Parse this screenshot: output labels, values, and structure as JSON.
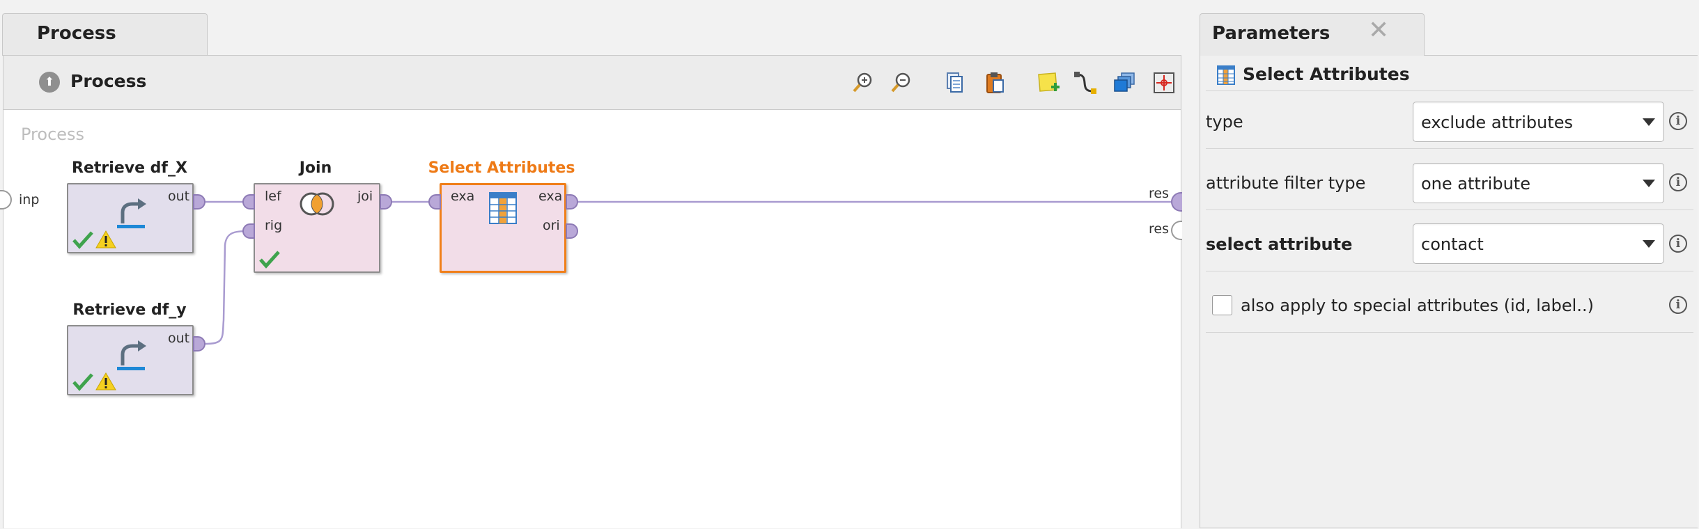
{
  "process_panel": {
    "tab_label": "Process",
    "breadcrumb": "Process",
    "canvas_title": "Process",
    "toolbar_icons": [
      "zoom-in-icon",
      "zoom-out-icon",
      "copy-icon",
      "paste-icon",
      "add-note-icon",
      "auto-wire-icon",
      "layers-icon",
      "fit-view-icon"
    ],
    "input_port_label": "inp",
    "result_ports": [
      "res",
      "res"
    ]
  },
  "operators": {
    "retrieve_x": {
      "title": "Retrieve df_X",
      "out_port": "out",
      "status": [
        "check-icon",
        "warning-icon"
      ]
    },
    "retrieve_y": {
      "title": "Retrieve df_y",
      "out_port": "out",
      "status": [
        "check-icon",
        "warning-icon"
      ]
    },
    "join": {
      "title": "Join",
      "in_ports": [
        "lef",
        "rig"
      ],
      "out_port": "joi",
      "status": [
        "check-icon"
      ]
    },
    "select_attributes": {
      "title": "Select Attributes",
      "in_port": "exa",
      "out_ports": [
        "exa",
        "ori"
      ],
      "selected": true
    }
  },
  "parameters_panel": {
    "tab_label": "Parameters",
    "close_symbol": "✕",
    "operator_name": "Select Attributes",
    "params": [
      {
        "label": "type",
        "value": "exclude attributes",
        "bold": false
      },
      {
        "label": "attribute filter type",
        "value": "one attribute",
        "bold": false
      },
      {
        "label": "select attribute",
        "value": "contact",
        "bold": true
      }
    ],
    "checkbox": {
      "label": "also apply to special attributes (id, label..)",
      "checked": false
    },
    "info_symbol": "i"
  },
  "colors": {
    "selected_operator": "#ee7a16",
    "port_fill": "#b9a8d8",
    "wire": "#a99bd0",
    "check": "#3fa34d",
    "warning": "#f5d020"
  }
}
